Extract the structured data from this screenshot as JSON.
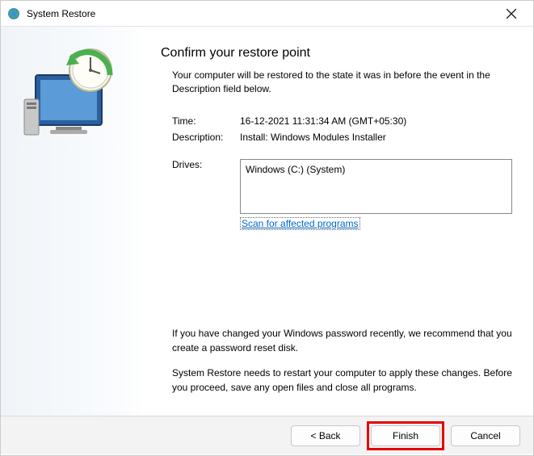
{
  "window": {
    "title": "System Restore"
  },
  "heading": "Confirm your restore point",
  "subtext": "Your computer will be restored to the state it was in before the event in the Description field below.",
  "fields": {
    "time_label": "Time:",
    "time_value": "16-12-2021 11:31:34 AM (GMT+05:30)",
    "description_label": "Description:",
    "description_value": "Install: Windows Modules Installer",
    "drives_label": "Drives:",
    "drives_value": "Windows (C:) (System)"
  },
  "scan_link": "Scan for affected programs",
  "info1": "If you have changed your Windows password recently, we recommend that you create a password reset disk.",
  "info2": "System Restore needs to restart your computer to apply these changes. Before you proceed, save any open files and close all programs.",
  "buttons": {
    "back": "< Back",
    "finish": "Finish",
    "cancel": "Cancel"
  }
}
